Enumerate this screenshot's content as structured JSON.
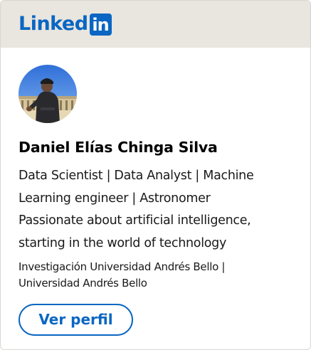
{
  "brand": {
    "word": "Linked",
    "box": "in",
    "color": "#0a66c2"
  },
  "profile": {
    "name": "Daniel Elías Chinga Silva",
    "headline_lines": [
      "Data Scientist | Data Analyst | Machine",
      "Learning engineer | Astronomer",
      "Passionate about artificial intelligence,",
      "starting in the world of technology"
    ],
    "organization_lines": [
      "Investigación Universidad Andrés Bello |",
      "Universidad Andrés Bello"
    ]
  },
  "actions": {
    "view_profile_label": "Ver perfil"
  }
}
